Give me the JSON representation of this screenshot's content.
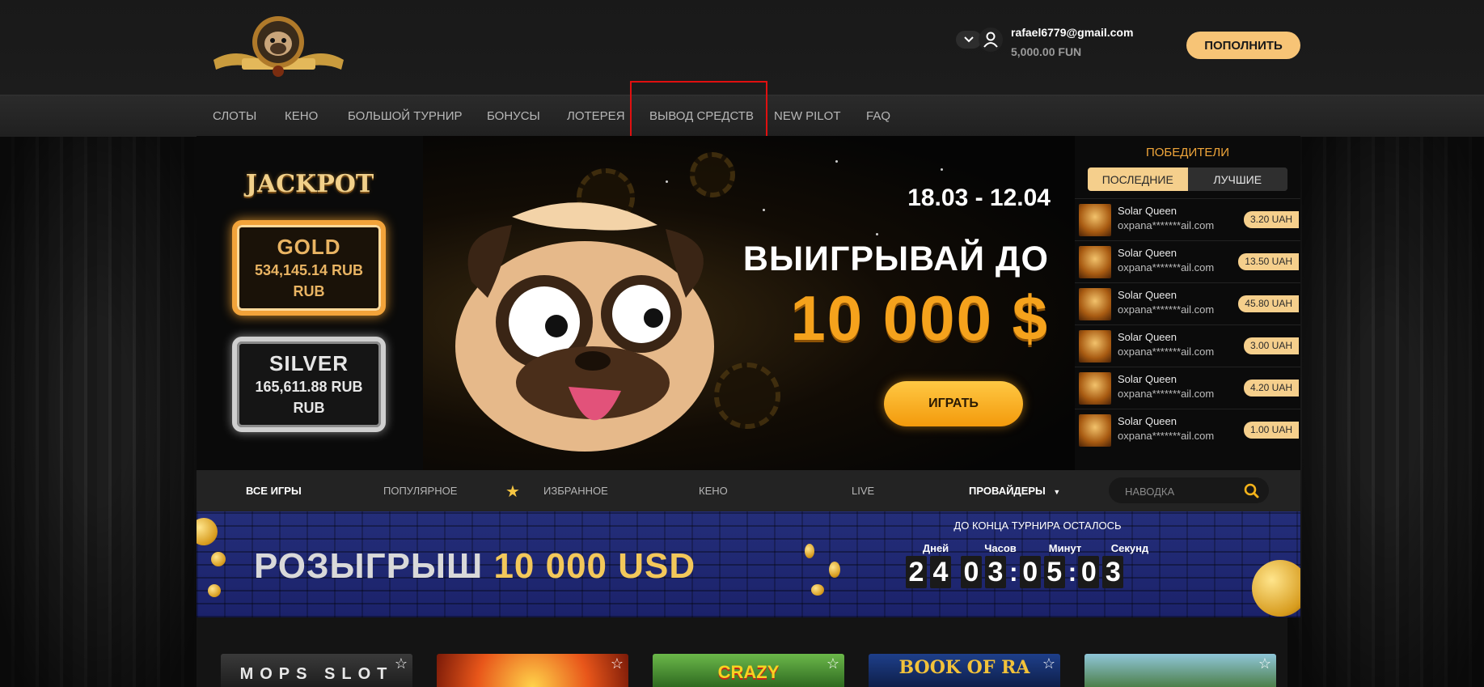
{
  "header": {
    "user_email": "rafael6779@gmail.com",
    "user_balance": "5,000.00 FUN",
    "topup_label": "ПОПОЛНИТЬ"
  },
  "nav": [
    {
      "label": "СЛОТЫ"
    },
    {
      "label": "КЕНО"
    },
    {
      "label": "БОЛЬШОЙ ТУРНИР"
    },
    {
      "label": "БОНУСЫ"
    },
    {
      "label": "ЛОТЕРЕЯ"
    },
    {
      "label": "ВЫВОД СРЕДСТВ"
    },
    {
      "label": "NEW PILOT"
    },
    {
      "label": "FAQ"
    }
  ],
  "jackpot": {
    "title": "JACKPOT",
    "gold": {
      "name": "GOLD",
      "value": "534,145.14 RUB",
      "currency": "RUB"
    },
    "silver": {
      "name": "SILVER",
      "value": "165,611.88 RUB",
      "currency": "RUB"
    }
  },
  "promo": {
    "dates": "18.03 - 12.04",
    "line1": "ВЫИГРЫВАЙ ДО",
    "line2": "10 000 $",
    "play_label": "ИГРАТЬ"
  },
  "winners": {
    "title": "ПОБЕДИТЕЛИ",
    "tabs": [
      {
        "label": "ПОСЛЕДНИЕ"
      },
      {
        "label": "ЛУЧШИЕ"
      }
    ],
    "list": [
      {
        "game": "Solar Queen",
        "user": "oxpana*******ail.com",
        "amount": "3.20 UAH"
      },
      {
        "game": "Solar Queen",
        "user": "oxpana*******ail.com",
        "amount": "13.50 UAH"
      },
      {
        "game": "Solar Queen",
        "user": "oxpana*******ail.com",
        "amount": "45.80 UAH"
      },
      {
        "game": "Solar Queen",
        "user": "oxpana*******ail.com",
        "amount": "3.00 UAH"
      },
      {
        "game": "Solar Queen",
        "user": "oxpana*******ail.com",
        "amount": "4.20 UAH"
      },
      {
        "game": "Solar Queen",
        "user": "oxpana*******ail.com",
        "amount": "1.00 UAH"
      }
    ]
  },
  "filters": {
    "items": [
      {
        "label": "ВСЕ ИГРЫ"
      },
      {
        "label": "ПОПУЛЯРНОЕ"
      },
      {
        "label": "ИЗБРАННОЕ"
      },
      {
        "label": "КЕНО"
      },
      {
        "label": "LIVE"
      },
      {
        "label": "ПРОВАЙДЕРЫ"
      }
    ],
    "search_placeholder": "НАВОДКА"
  },
  "tournament": {
    "title_prefix": "РОЗЫГРЫШ",
    "title_amount": "10 000 USD",
    "time_left_label": "ДО КОНЦА ТУРНИРА ОСТАЛОСЬ",
    "labels": [
      "Дней",
      "Часов",
      "Минут",
      "Секунд"
    ],
    "digits": [
      "2",
      "4",
      "0",
      "3",
      "0",
      "5",
      "0",
      "3"
    ]
  },
  "games": [
    {
      "title": "MOPS SLOT"
    },
    {
      "title": ""
    },
    {
      "title": "CRAZY"
    },
    {
      "title": "BOOK OF RA"
    },
    {
      "title": ""
    }
  ],
  "colors": {
    "accent": "#f7c476",
    "highlight_box": "#e01010",
    "promo_orange": "#f5a21c",
    "tournament_blue": "#1f2873"
  }
}
